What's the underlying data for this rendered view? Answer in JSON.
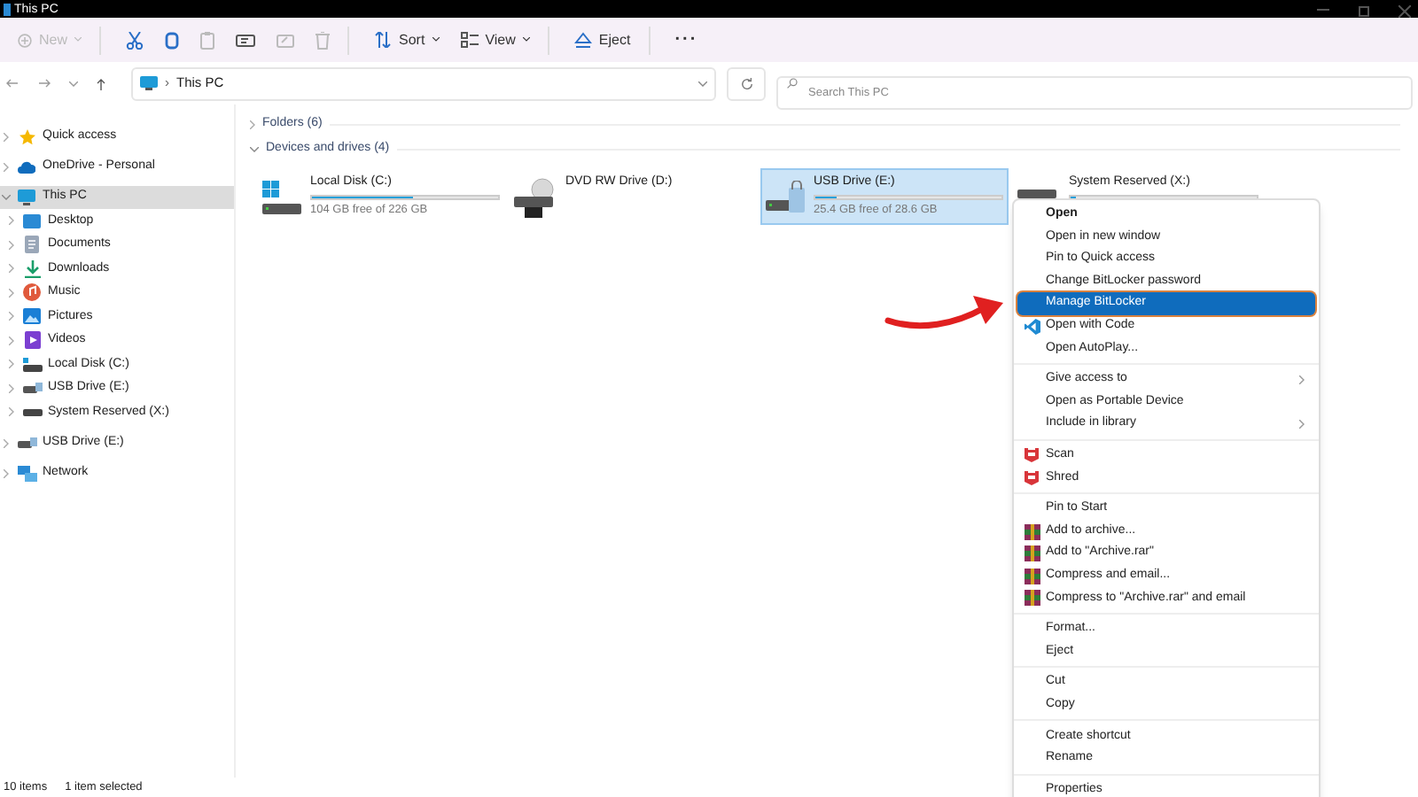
{
  "window": {
    "title": "This PC"
  },
  "toolbar": [
    {
      "kind": "new",
      "label": "New",
      "disabled": true
    },
    {
      "kind": "cut",
      "disabled": false
    },
    {
      "kind": "copy",
      "disabled": false
    },
    {
      "kind": "paste",
      "disabled": true
    },
    {
      "kind": "rename",
      "disabled": false
    },
    {
      "kind": "share",
      "disabled": true
    },
    {
      "kind": "delete",
      "disabled": true
    },
    {
      "kind": "sort",
      "label": "Sort",
      "disabled": false
    },
    {
      "kind": "view",
      "label": "View",
      "disabled": false
    },
    {
      "kind": "eject",
      "label": "Eject",
      "disabled": false
    },
    {
      "kind": "more",
      "label": "···",
      "disabled": false
    }
  ],
  "address": {
    "separator": "›",
    "path": "This PC",
    "search_placeholder": "Search This PC"
  },
  "sidebar": [
    {
      "label": "Quick access",
      "kind": "star",
      "expanded": false,
      "selected": false
    },
    {
      "label": "OneDrive - Personal",
      "kind": "cloud",
      "expanded": false,
      "selected": false
    },
    {
      "label": "This PC",
      "kind": "pc",
      "expanded": true,
      "selected": true,
      "children": [
        {
          "label": "Desktop",
          "kind": "desktop",
          "expanded": false,
          "selected": false
        },
        {
          "label": "Documents",
          "kind": "documents",
          "expanded": false,
          "selected": false
        },
        {
          "label": "Downloads",
          "kind": "downloads",
          "expanded": false,
          "selected": false
        },
        {
          "label": "Music",
          "kind": "music",
          "expanded": false,
          "selected": false
        },
        {
          "label": "Pictures",
          "kind": "pictures",
          "expanded": false,
          "selected": false
        },
        {
          "label": "Videos",
          "kind": "videos",
          "expanded": false,
          "selected": false
        },
        {
          "label": "Local Disk (C:)",
          "kind": "disk",
          "expanded": false,
          "selected": false
        },
        {
          "label": "USB Drive (E:)",
          "kind": "usb",
          "expanded": false,
          "selected": false
        },
        {
          "label": "System Reserved (X:)",
          "kind": "drive",
          "expanded": false,
          "selected": false
        }
      ]
    },
    {
      "label": "USB Drive (E:)",
      "kind": "usb",
      "expanded": false,
      "selected": false
    },
    {
      "label": "Network",
      "kind": "network",
      "expanded": false,
      "selected": false
    }
  ],
  "sections": [
    {
      "label": "Folders (6)",
      "expanded": false
    },
    {
      "label": "Devices and drives (4)",
      "expanded": true
    }
  ],
  "drives": [
    {
      "name": "Local Disk (C:)",
      "kind": "system",
      "level": 0.54,
      "free": "104 GB free of 226 GB",
      "selected": false
    },
    {
      "name": "DVD RW Drive (D:)",
      "kind": "dvd",
      "selected": false
    },
    {
      "name": "USB Drive (E:)",
      "kind": "usb",
      "level": 0.11,
      "free": "25.4 GB free of 28.6 GB",
      "selected": true
    },
    {
      "name": "System Reserved (X:)",
      "kind": "drive",
      "level": 0.03,
      "selected": false
    }
  ],
  "context_menu": [
    [
      {
        "label": "Open",
        "default": true,
        "selected": false
      },
      {
        "label": "Open in new window",
        "selected": false
      },
      {
        "label": "Pin to Quick access",
        "selected": false
      },
      {
        "label": "Change BitLocker password",
        "selected": false
      },
      {
        "label": "Manage BitLocker",
        "selected": true
      },
      {
        "label": "Open with Code",
        "kind": "vscode",
        "selected": false
      },
      {
        "label": "Open AutoPlay...",
        "selected": false
      }
    ],
    [
      {
        "label": "Give access to",
        "submenu": true,
        "selected": false
      },
      {
        "label": "Open as Portable Device",
        "selected": false
      },
      {
        "label": "Include in library",
        "submenu": true,
        "selected": false
      }
    ],
    [
      {
        "label": "Scan",
        "kind": "shield",
        "selected": false
      },
      {
        "label": "Shred",
        "kind": "shield",
        "selected": false
      }
    ],
    [
      {
        "label": "Pin to Start",
        "selected": false
      },
      {
        "label": "Add to archive...",
        "kind": "archive",
        "selected": false
      },
      {
        "label": "Add to \"Archive.rar\"",
        "kind": "archive",
        "selected": false
      },
      {
        "label": "Compress and email...",
        "kind": "archive",
        "selected": false
      },
      {
        "label": "Compress to \"Archive.rar\" and email",
        "kind": "archive",
        "selected": false
      }
    ],
    [
      {
        "label": "Format...",
        "selected": false
      },
      {
        "label": "Eject",
        "selected": false
      }
    ],
    [
      {
        "label": "Cut",
        "selected": false
      },
      {
        "label": "Copy",
        "selected": false
      }
    ],
    [
      {
        "label": "Create shortcut",
        "selected": false
      },
      {
        "label": "Rename",
        "selected": false
      }
    ],
    [
      {
        "label": "Properties",
        "selected": false
      }
    ]
  ],
  "status_bar": {
    "count": "10 items",
    "selection": "1 item selected"
  }
}
